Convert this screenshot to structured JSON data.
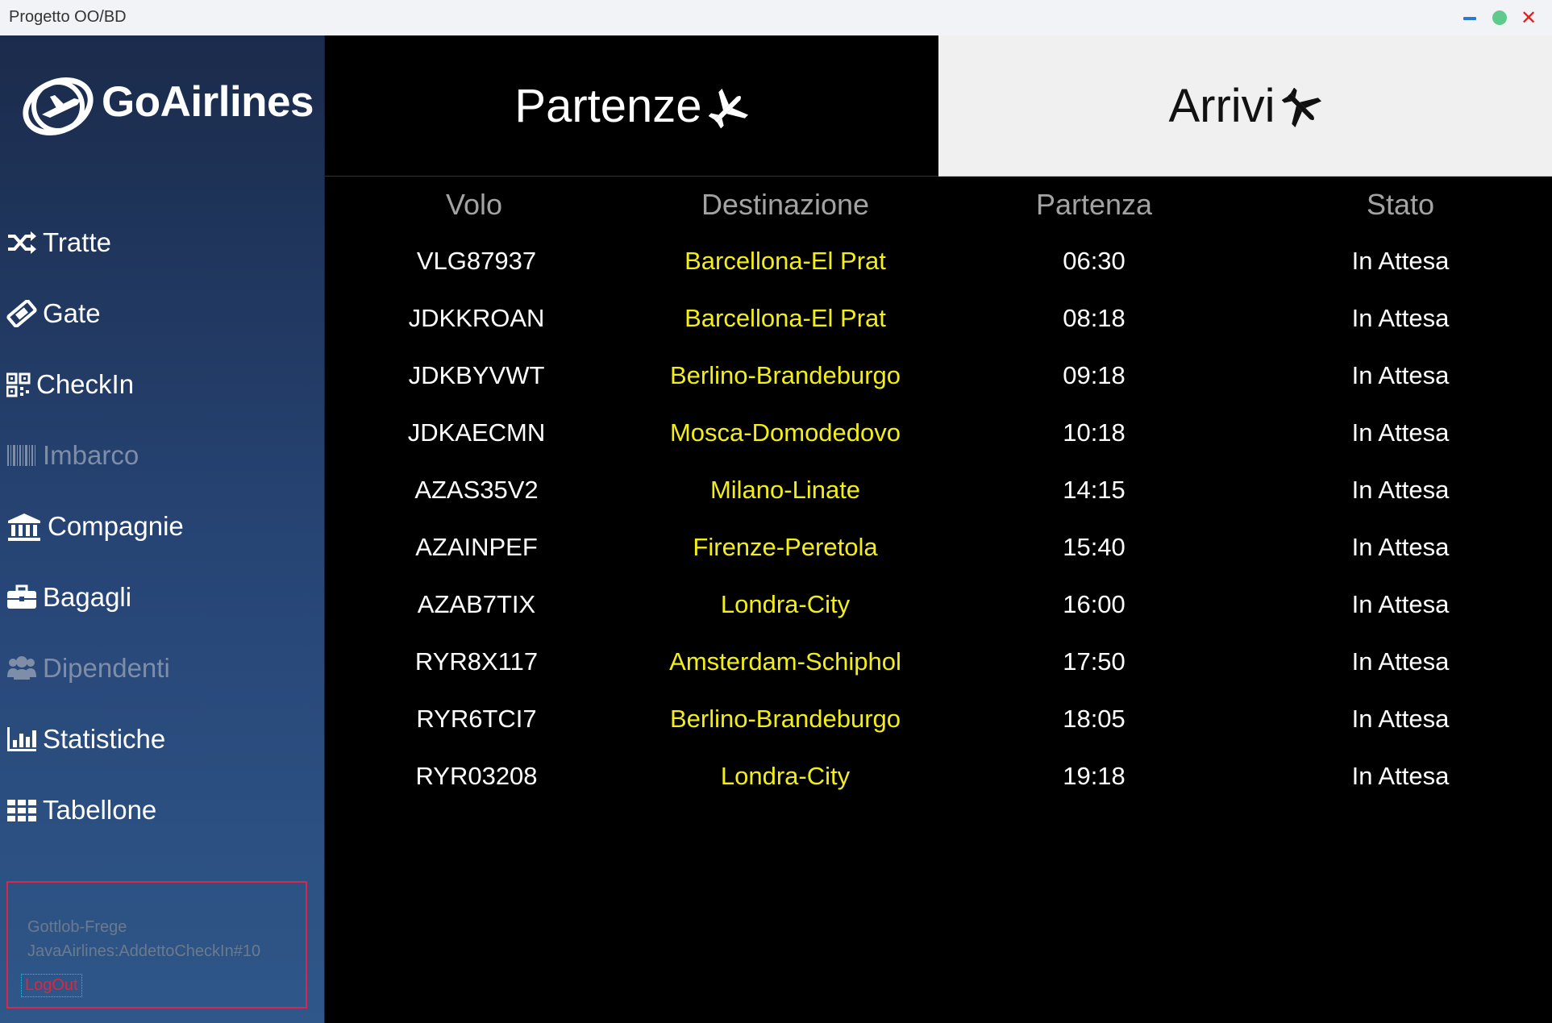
{
  "window": {
    "title": "Progetto OO/BD",
    "close_glyph": "✕"
  },
  "logo": {
    "text": "GoAirlines",
    "icon": "globe-plane-icon"
  },
  "sidebar": {
    "items": [
      {
        "label": "Tratte",
        "icon": "shuffle-icon",
        "enabled": true
      },
      {
        "label": "Gate",
        "icon": "ticket-icon",
        "enabled": true
      },
      {
        "label": "CheckIn",
        "icon": "qrcode-icon",
        "enabled": true
      },
      {
        "label": "Imbarco",
        "icon": "barcode-icon",
        "enabled": false
      },
      {
        "label": "Compagnie",
        "icon": "bank-icon",
        "enabled": true
      },
      {
        "label": "Bagagli",
        "icon": "briefcase-icon",
        "enabled": true
      },
      {
        "label": "Dipendenti",
        "icon": "users-icon",
        "enabled": false
      },
      {
        "label": "Statistiche",
        "icon": "bar-chart-icon",
        "enabled": true
      },
      {
        "label": "Tabellone",
        "icon": "grid-icon",
        "enabled": true
      }
    ]
  },
  "user": {
    "name": "Gottlob-Frege",
    "role": "JavaAirlines:AddettoCheckIn#10",
    "logout_label": "LogOut"
  },
  "tabs": [
    {
      "label": "Partenze",
      "icon": "plane-takeoff-icon",
      "active": true
    },
    {
      "label": "Arrivi",
      "icon": "plane-landing-icon",
      "active": false
    }
  ],
  "board": {
    "headers": {
      "volo": "Volo",
      "destinazione": "Destinazione",
      "partenza": "Partenza",
      "stato": "Stato"
    },
    "rows": [
      {
        "volo": "VLG87937",
        "destinazione": "Barcellona-El Prat",
        "partenza": "06:30",
        "stato": "In Attesa"
      },
      {
        "volo": "JDKKROAN",
        "destinazione": "Barcellona-El Prat",
        "partenza": "08:18",
        "stato": "In Attesa"
      },
      {
        "volo": "JDKBYVWT",
        "destinazione": "Berlino-Brandeburgo",
        "partenza": "09:18",
        "stato": "In Attesa"
      },
      {
        "volo": "JDKAECMN",
        "destinazione": "Mosca-Domodedovo",
        "partenza": "10:18",
        "stato": "In Attesa"
      },
      {
        "volo": "AZAS35V2",
        "destinazione": "Milano-Linate",
        "partenza": "14:15",
        "stato": "In Attesa"
      },
      {
        "volo": "AZAINPEF",
        "destinazione": "Firenze-Peretola",
        "partenza": "15:40",
        "stato": "In Attesa"
      },
      {
        "volo": "AZAB7TIX",
        "destinazione": "Londra-City",
        "partenza": "16:00",
        "stato": "In Attesa"
      },
      {
        "volo": "RYR8X117",
        "destinazione": "Amsterdam-Schiphol",
        "partenza": "17:50",
        "stato": "In Attesa"
      },
      {
        "volo": "RYR6TCI7",
        "destinazione": "Berlino-Brandeburgo",
        "partenza": "18:05",
        "stato": "In Attesa"
      },
      {
        "volo": "RYR03208",
        "destinazione": "Londra-City",
        "partenza": "19:18",
        "stato": "In Attesa"
      }
    ]
  },
  "colors": {
    "destination": "#f1ee19",
    "header": "#a3a3a3",
    "sidebar_top": "#1b2b4b",
    "sidebar_bottom": "#2f5789"
  }
}
